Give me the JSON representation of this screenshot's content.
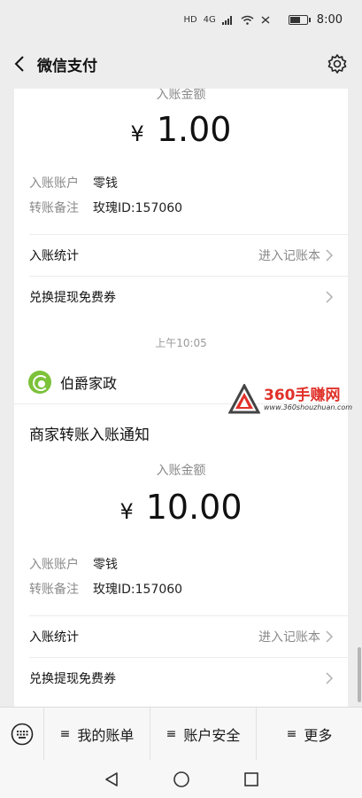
{
  "status_bar": {
    "network_left": "HD",
    "network_gen": "4G",
    "time": "8:00"
  },
  "nav": {
    "title": "微信支付"
  },
  "notifications": [
    {
      "amount_label": "入账金额",
      "currency_symbol": "¥",
      "amount": "1.00",
      "account_label": "入账账户",
      "account_value": "零钱",
      "remark_label": "转账备注",
      "remark_value": "玫瑰ID:157060",
      "stats_label": "入账统计",
      "stats_link": "进入记账本",
      "voucher_label": "兑换提现免费券"
    },
    {
      "merchant": "伯爵家政",
      "title": "商家转账入账通知",
      "amount_label": "入账金额",
      "currency_symbol": "¥",
      "amount": "10.00",
      "account_label": "入账账户",
      "account_value": "零钱",
      "remark_label": "转账备注",
      "remark_value": "玫瑰ID:157060",
      "stats_label": "入账统计",
      "stats_link": "进入记账本",
      "voucher_label": "兑换提现免费券"
    }
  ],
  "timestamp": "上午10:05",
  "watermark": {
    "main": "360手赚网",
    "sub": "www.360shouzhuan.com"
  },
  "menu": {
    "items": [
      {
        "icon": "≡",
        "label": "我的账单"
      },
      {
        "icon": "≡",
        "label": "账户安全"
      },
      {
        "icon": "≡",
        "label": "更多"
      }
    ]
  },
  "colors": {
    "background": "#ededed",
    "card": "#ffffff",
    "merchant_logo": "#7cc23a",
    "watermark_red": "#e0312a"
  },
  "icons": [
    "back-arrow-icon",
    "settings-gear-icon",
    "keyboard-icon",
    "chevron-right-icon",
    "nav-back-icon",
    "nav-home-icon",
    "nav-recents-icon"
  ]
}
